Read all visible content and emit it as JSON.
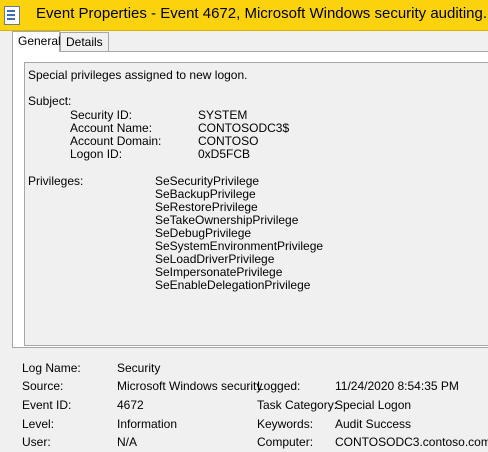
{
  "window": {
    "title": "Event Properties - Event 4672, Microsoft Windows security auditing."
  },
  "tabs": [
    {
      "label": "General",
      "active": true
    },
    {
      "label": "Details",
      "active": false
    }
  ],
  "description": {
    "headline": "Special privileges assigned to new logon.",
    "subject_label": "Subject:",
    "subject": [
      {
        "label": "Security ID:",
        "value": "SYSTEM"
      },
      {
        "label": "Account Name:",
        "value": "CONTOSODC3$"
      },
      {
        "label": "Account Domain:",
        "value": "CONTOSO"
      },
      {
        "label": "Logon ID:",
        "value": "0xD5FCB"
      }
    ],
    "privileges_label": "Privileges:",
    "privileges": [
      "SeSecurityPrivilege",
      "SeBackupPrivilege",
      "SeRestorePrivilege",
      "SeTakeOwnershipPrivilege",
      "SeDebugPrivilege",
      "SeSystemEnvironmentPrivilege",
      "SeLoadDriverPrivilege",
      "SeImpersonatePrivilege",
      "SeEnableDelegationPrivilege"
    ]
  },
  "details": {
    "log_name": {
      "label": "Log Name:",
      "value": "Security"
    },
    "source": {
      "label": "Source:",
      "value": "Microsoft Windows security"
    },
    "logged": {
      "label": "Logged:",
      "value": "11/24/2020 8:54:35 PM"
    },
    "event_id": {
      "label": "Event ID:",
      "value": "4672"
    },
    "task_category": {
      "label": "Task Category:",
      "value": "Special Logon"
    },
    "level": {
      "label": "Level:",
      "value": "Information"
    },
    "keywords": {
      "label": "Keywords:",
      "value": "Audit Success"
    },
    "user": {
      "label": "User:",
      "value": "N/A"
    },
    "computer": {
      "label": "Computer:",
      "value": "CONTOSODC3.contoso.com"
    }
  },
  "colors": {
    "titlebar": "#fbd20b",
    "window_bg": "#f0f0f0",
    "panel_bg": "#ffffff"
  }
}
